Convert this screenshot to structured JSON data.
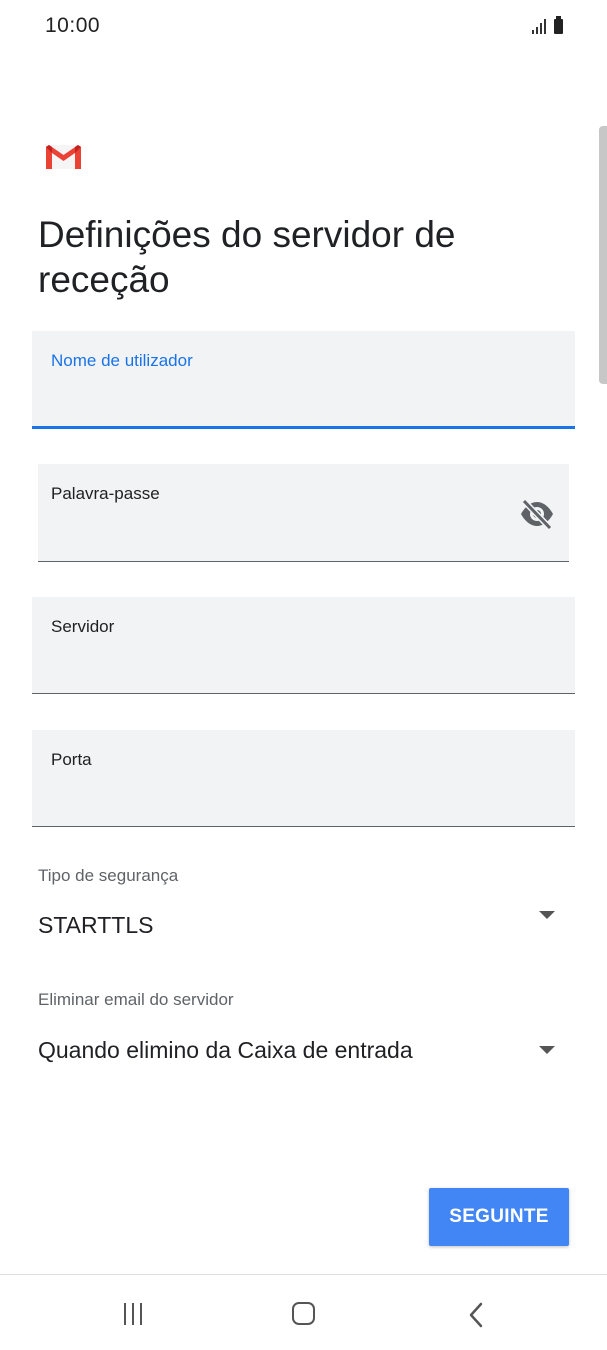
{
  "status_bar": {
    "time": "10:00"
  },
  "header": {
    "title": "Definições do servidor de receção",
    "logo": "gmail-logo"
  },
  "fields": {
    "username": {
      "label": "Nome de utilizador",
      "value": ""
    },
    "password": {
      "label": "Palavra-passe",
      "value": "",
      "icon": "eye-off-icon"
    },
    "server": {
      "label": "Servidor",
      "value": ""
    },
    "port": {
      "label": "Porta",
      "value": ""
    }
  },
  "security": {
    "label": "Tipo de segurança",
    "value": "STARTTLS"
  },
  "delete_mail": {
    "label": "Eliminar email do servidor",
    "value": "Quando elimino da Caixa de entrada"
  },
  "actions": {
    "next_label": "SEGUINTE"
  },
  "colors": {
    "accent": "#1a73e8",
    "button": "#4285f4",
    "gmail_red": "#ea4335"
  }
}
